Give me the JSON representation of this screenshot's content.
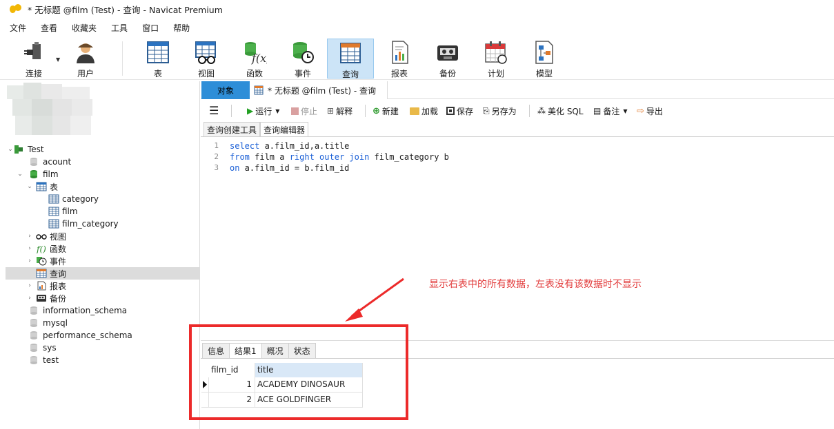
{
  "window": {
    "title": "* 无标题 @film (Test) - 查询 - Navicat Premium"
  },
  "menu": [
    "文件",
    "查看",
    "收藏夹",
    "工具",
    "窗口",
    "帮助"
  ],
  "toolbar": {
    "buttons": [
      {
        "label": "连接",
        "icon": "plug-icon"
      },
      {
        "label": "用户",
        "icon": "user-icon"
      },
      {
        "label": "表",
        "icon": "table-icon"
      },
      {
        "label": "视图",
        "icon": "view-icon"
      },
      {
        "label": "函数",
        "icon": "function-icon"
      },
      {
        "label": "事件",
        "icon": "event-icon"
      },
      {
        "label": "查询",
        "icon": "query-icon",
        "active": true
      },
      {
        "label": "报表",
        "icon": "report-icon"
      },
      {
        "label": "备份",
        "icon": "backup-icon"
      },
      {
        "label": "计划",
        "icon": "schedule-icon"
      },
      {
        "label": "模型",
        "icon": "model-icon"
      }
    ]
  },
  "tree": {
    "connection": "Test",
    "items": [
      {
        "label": "acount",
        "kind": "db",
        "level": 1
      },
      {
        "label": "film",
        "kind": "db-open",
        "level": 1
      },
      {
        "label": "表",
        "kind": "tables",
        "level": 2
      },
      {
        "label": "category",
        "kind": "table",
        "level": 3
      },
      {
        "label": "film",
        "kind": "table",
        "level": 3
      },
      {
        "label": "film_category",
        "kind": "table",
        "level": 3
      },
      {
        "label": "视图",
        "kind": "views",
        "level": 2
      },
      {
        "label": "函数",
        "kind": "functions",
        "level": 2
      },
      {
        "label": "事件",
        "kind": "events",
        "level": 2
      },
      {
        "label": "查询",
        "kind": "queries",
        "level": 2,
        "selected": true
      },
      {
        "label": "报表",
        "kind": "reports",
        "level": 2
      },
      {
        "label": "备份",
        "kind": "backups",
        "level": 2
      },
      {
        "label": "information_schema",
        "kind": "db",
        "level": 1
      },
      {
        "label": "mysql",
        "kind": "db",
        "level": 1
      },
      {
        "label": "performance_schema",
        "kind": "db",
        "level": 1
      },
      {
        "label": "sys",
        "kind": "db",
        "level": 1
      },
      {
        "label": "test",
        "kind": "db",
        "level": 1
      }
    ]
  },
  "tabs": {
    "objects": "对象",
    "query_doc": "* 无标题 @film (Test) - 查询"
  },
  "commands": {
    "run": "运行",
    "stop": "停止",
    "explain": "解释",
    "new": "新建",
    "load": "加载",
    "save": "保存",
    "save_as": "另存为",
    "beautify": "美化 SQL",
    "comment": "备注",
    "export": "导出"
  },
  "subtabs": {
    "builder": "查询创建工具",
    "editor": "查询编辑器"
  },
  "editor": {
    "line_numbers": [
      "1",
      "2",
      "3"
    ],
    "lines": [
      [
        {
          "t": "select",
          "k": true
        },
        {
          "t": " a.film_id,a.title",
          "k": false
        }
      ],
      [
        {
          "t": "from",
          "k": true
        },
        {
          "t": " film a ",
          "k": false
        },
        {
          "t": "right outer join",
          "k": true
        },
        {
          "t": " film_category b",
          "k": false
        }
      ],
      [
        {
          "t": "on",
          "k": true
        },
        {
          "t": " a.film_id = b.film_id",
          "k": false
        }
      ]
    ]
  },
  "annotation": "显示右表中的所有数据，左表没有该数据时不显示",
  "result_tabs": {
    "info": "信息",
    "result": "结果1",
    "profile": "概况",
    "status": "状态"
  },
  "result": {
    "columns": [
      "film_id",
      "title"
    ],
    "rows": [
      [
        "1",
        "ACADEMY DINOSAUR"
      ],
      [
        "2",
        "ACE GOLDFINGER"
      ]
    ]
  },
  "colors": {
    "accent": "#2e8ed8",
    "keyword": "#1a5fd6",
    "annotation": "#e23b3b",
    "highlight_box": "#ec2a2a"
  }
}
